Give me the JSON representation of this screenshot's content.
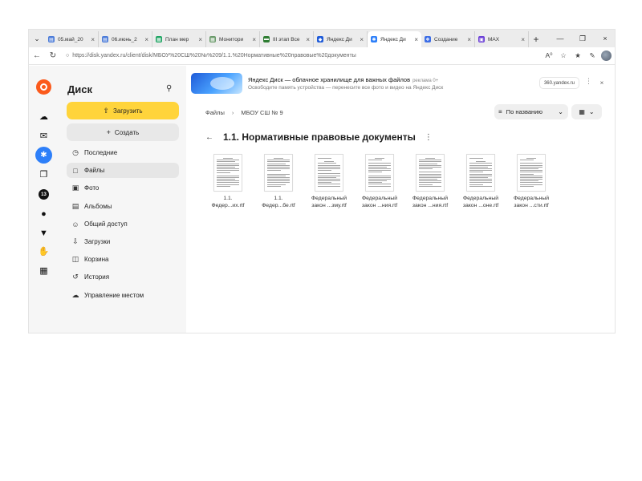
{
  "browser": {
    "tabs": [
      {
        "label": "05.май_20",
        "icon": "doc-icon",
        "color": "#4b7bd8"
      },
      {
        "label": "06.июнь_2",
        "icon": "doc-icon",
        "color": "#4b7bd8"
      },
      {
        "label": "План мер",
        "icon": "sheet-icon",
        "color": "#1fa463"
      },
      {
        "label": "Монитори",
        "icon": "table-icon",
        "color": "#6a9a6a"
      },
      {
        "label": "III этап Все",
        "icon": "bar-icon",
        "color": "#2e7d32"
      },
      {
        "label": "Яндекс Ди",
        "icon": "yandex-icon",
        "color": "#1f5bd8"
      },
      {
        "label": "Яндекс Ди",
        "icon": "disk-icon",
        "color": "#2d7ff9",
        "active": true
      },
      {
        "label": "Создание",
        "icon": "puzzle-icon",
        "color": "#3d6ee6"
      },
      {
        "label": "MAX",
        "icon": "max-icon",
        "color": "#6b3fd6"
      }
    ],
    "url": "https://disk.yandex.ru/client/disk/МБОУ%20СШ%20№%209/1.1.%20Нормативные%20правовые%20документы"
  },
  "sidebar": {
    "title": "Диск",
    "upload_label": "Загрузить",
    "create_label": "Создать",
    "items": [
      {
        "label": "Последние",
        "icon": "clock-icon"
      },
      {
        "label": "Файлы",
        "icon": "folder-icon",
        "active": true
      },
      {
        "label": "Фото",
        "icon": "photo-icon"
      },
      {
        "label": "Альбомы",
        "icon": "album-icon"
      },
      {
        "label": "Общий доступ",
        "icon": "people-icon"
      },
      {
        "label": "Загрузки",
        "icon": "download-icon"
      },
      {
        "label": "Корзина",
        "icon": "trash-icon"
      },
      {
        "label": "История",
        "icon": "history-icon"
      },
      {
        "label": "Управление местом",
        "icon": "cloud-icon"
      }
    ]
  },
  "rail": {
    "badge": "13"
  },
  "ad": {
    "title": "Яндекс Диск — облачное хранилище для важных файлов",
    "mark": "реклама 0+",
    "subtitle": "Освободите память устройства — перенесите все фото и видео на Яндекс Диск",
    "domain": "360.yandex.ru"
  },
  "breadcrumbs": [
    "Файлы",
    "МБОУ СШ № 9"
  ],
  "sort": {
    "label": "По названию"
  },
  "folder": {
    "title": "1.1. Нормативные правовые документы"
  },
  "files": [
    {
      "line1": "1.1.",
      "line2": "Федер...их.rtf"
    },
    {
      "line1": "1.1.",
      "line2": "Федер...бе.rtf"
    },
    {
      "line1": "Федеральный",
      "line2": "закон ...зму.rtf"
    },
    {
      "line1": "Федеральный",
      "line2": "закон ...ния.rtf"
    },
    {
      "line1": "Федеральный",
      "line2": "закон ...ния.rtf"
    },
    {
      "line1": "Федеральный",
      "line2": "закон ...оне.rtf"
    },
    {
      "line1": "Федеральный",
      "line2": "закон ...сти.rtf"
    }
  ]
}
